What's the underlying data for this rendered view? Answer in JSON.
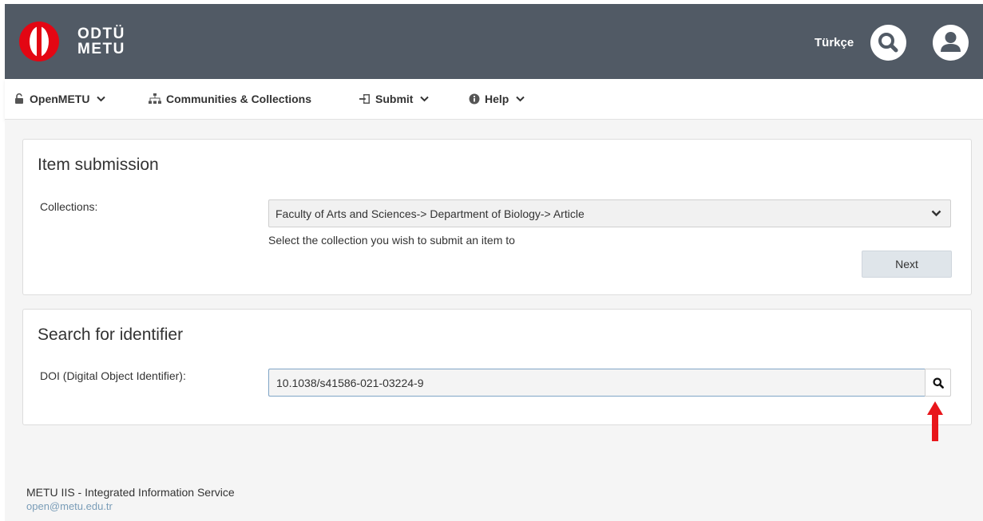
{
  "header": {
    "logo_line1": "ODTÜ",
    "logo_line2": "METU",
    "language": "Türkçe",
    "brand_color": "#515a65",
    "logo_color": "#e30613"
  },
  "nav": {
    "items": [
      {
        "label": "OpenMETU",
        "icon": "unlock-icon"
      },
      {
        "label": "Communities & Collections",
        "icon": "sitemap-icon"
      },
      {
        "label": "Submit",
        "icon": "submit-icon"
      },
      {
        "label": "Help",
        "icon": "info-circle-icon"
      }
    ]
  },
  "submission": {
    "title": "Item submission",
    "collections_label": "Collections:",
    "selected_collection": "Faculty of Arts and Sciences-> Department of Biology-> Article",
    "help_text": "Select the collection you wish to submit an item to",
    "next_label": "Next"
  },
  "identifier": {
    "title": "Search for identifier",
    "doi_label": "DOI (Digital Object Identifier):",
    "doi_value": "10.1038/s41586-021-03224-9"
  },
  "annotation": {
    "arrow_color": "#e8161b"
  },
  "footer": {
    "title": "METU IIS - Integrated Information Service",
    "email": "open@metu.edu.tr"
  }
}
